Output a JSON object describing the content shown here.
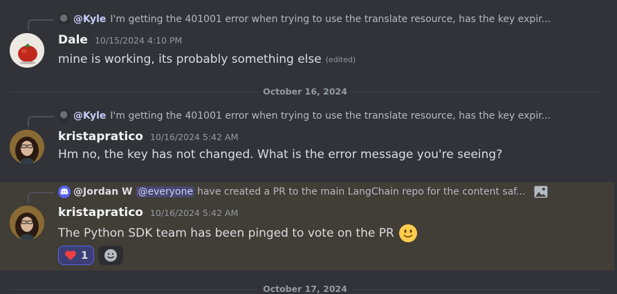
{
  "messages": [
    {
      "reply": {
        "author": "@Kyle",
        "text": "I'm getting the 401001 error when trying to use the translate resource, has the key expir..."
      },
      "username": "Dale",
      "timestamp": "10/15/2024 4:10 PM",
      "content": "mine is working, its probably something else",
      "edited": "(edited)",
      "avatar": "tomato-avatar"
    },
    {
      "reply": {
        "author": "@Kyle",
        "text": "I'm getting the 401001 error when trying to use the translate resource, has the key expir..."
      },
      "username": "kristapratico",
      "timestamp": "10/16/2024 5:42 AM",
      "content": "Hm no, the key has not changed. What is the error message you're seeing?",
      "avatar": "person-avatar"
    },
    {
      "reply": {
        "author": "@Jordan W",
        "mention": "@everyone",
        "text": "have created a PR to the main LangChain repo for the content saf..."
      },
      "username": "kristapratico",
      "timestamp": "10/16/2024 5:42 AM",
      "content": "The Python SDK team has been pinged to vote on the PR",
      "emoji": "slightly-smiling-face",
      "reactions": [
        {
          "emoji": "heart",
          "count": "1"
        }
      ],
      "avatar": "person-avatar"
    }
  ],
  "dividers": [
    "October 16, 2024",
    "October 17, 2024"
  ],
  "colors": {
    "background": "#313338",
    "highlight": "#413d37",
    "mention": "#5865f2",
    "heart": "#f23f43"
  }
}
